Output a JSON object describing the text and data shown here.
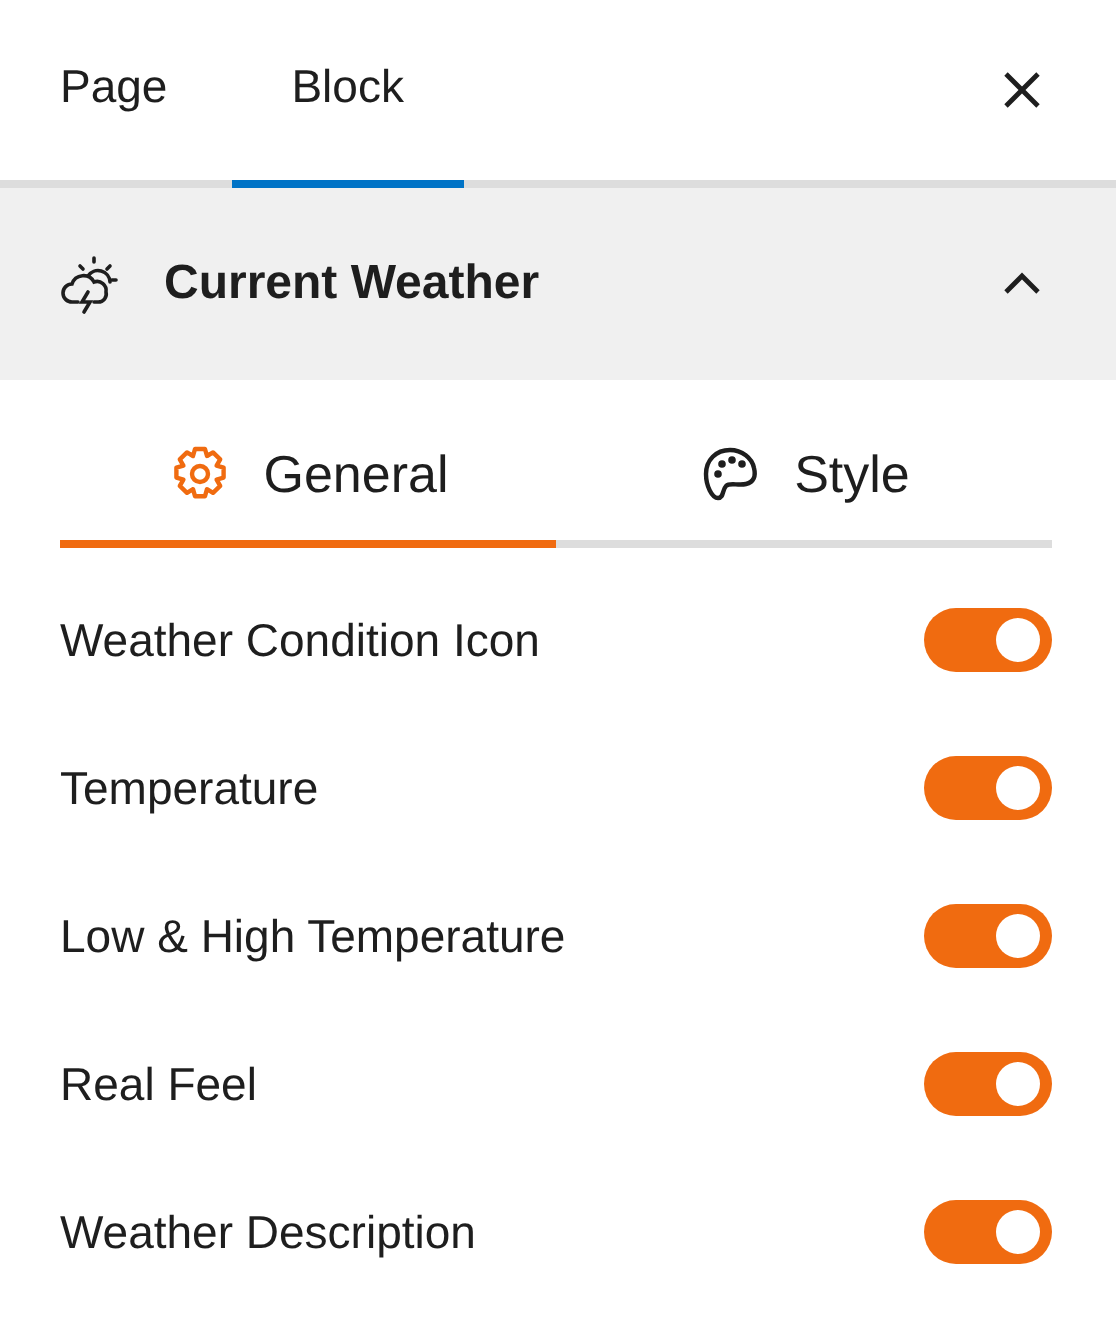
{
  "top_tabs": [
    {
      "label": "Page",
      "selected": false
    },
    {
      "label": "Block",
      "selected": true
    }
  ],
  "panel": {
    "title": "Current Weather",
    "expanded": true
  },
  "sub_tabs": [
    {
      "label": "General",
      "selected": true
    },
    {
      "label": "Style",
      "selected": false
    }
  ],
  "toggles": [
    {
      "label": "Weather Condition Icon",
      "on": true
    },
    {
      "label": "Temperature",
      "on": true
    },
    {
      "label": "Low & High Temperature",
      "on": true
    },
    {
      "label": "Real Feel",
      "on": true
    },
    {
      "label": "Weather Description",
      "on": true
    }
  ]
}
